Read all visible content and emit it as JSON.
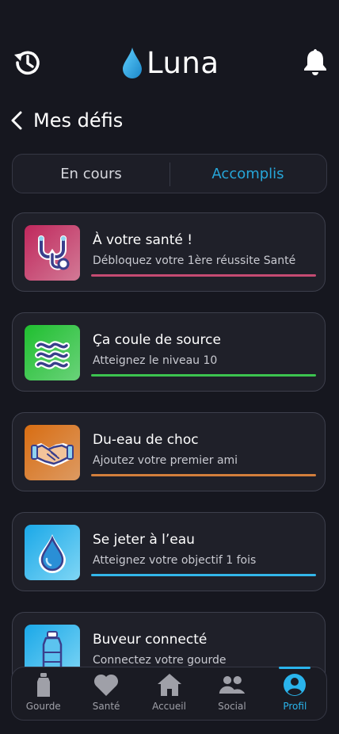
{
  "header": {
    "app_name": "Luna",
    "left_icon": "history-icon",
    "right_icon": "bell-icon"
  },
  "page": {
    "back_icon": "chevron-left-icon",
    "title": "Mes défis"
  },
  "tabs": [
    {
      "label": "En cours",
      "active": false
    },
    {
      "label": "Accomplis",
      "active": true
    }
  ],
  "challenges": [
    {
      "title": "À votre santé !",
      "subtitle": "Débloquez votre 1ère réussite Santé",
      "icon": "stethoscope-icon",
      "color": "#c54b72"
    },
    {
      "title": "Ça coule de source",
      "subtitle": "Atteignez le niveau 10",
      "icon": "waves-icon",
      "color": "#3cc44f"
    },
    {
      "title": "Du-eau de choc",
      "subtitle": "Ajoutez votre premier ami",
      "icon": "handshake-icon",
      "color": "#d27e3c"
    },
    {
      "title": "Se jeter à l’eau",
      "subtitle": "Atteignez votre objectif 1 fois",
      "icon": "water-drop-icon",
      "color": "#33b6ea"
    },
    {
      "title": "Buveur connecté",
      "subtitle": "Connectez votre gourde",
      "icon": "bottle-icon",
      "color": "#33b6ea"
    }
  ],
  "nav": [
    {
      "label": "Gourde",
      "icon": "bottle-icon",
      "active": false
    },
    {
      "label": "Santé",
      "icon": "heart-icon",
      "active": false
    },
    {
      "label": "Accueil",
      "icon": "home-icon",
      "active": false
    },
    {
      "label": "Social",
      "icon": "people-icon",
      "active": false
    },
    {
      "label": "Profil",
      "icon": "profile-icon",
      "active": true
    }
  ],
  "colors": {
    "background": "#16171f",
    "accent": "#2ab4ec"
  }
}
